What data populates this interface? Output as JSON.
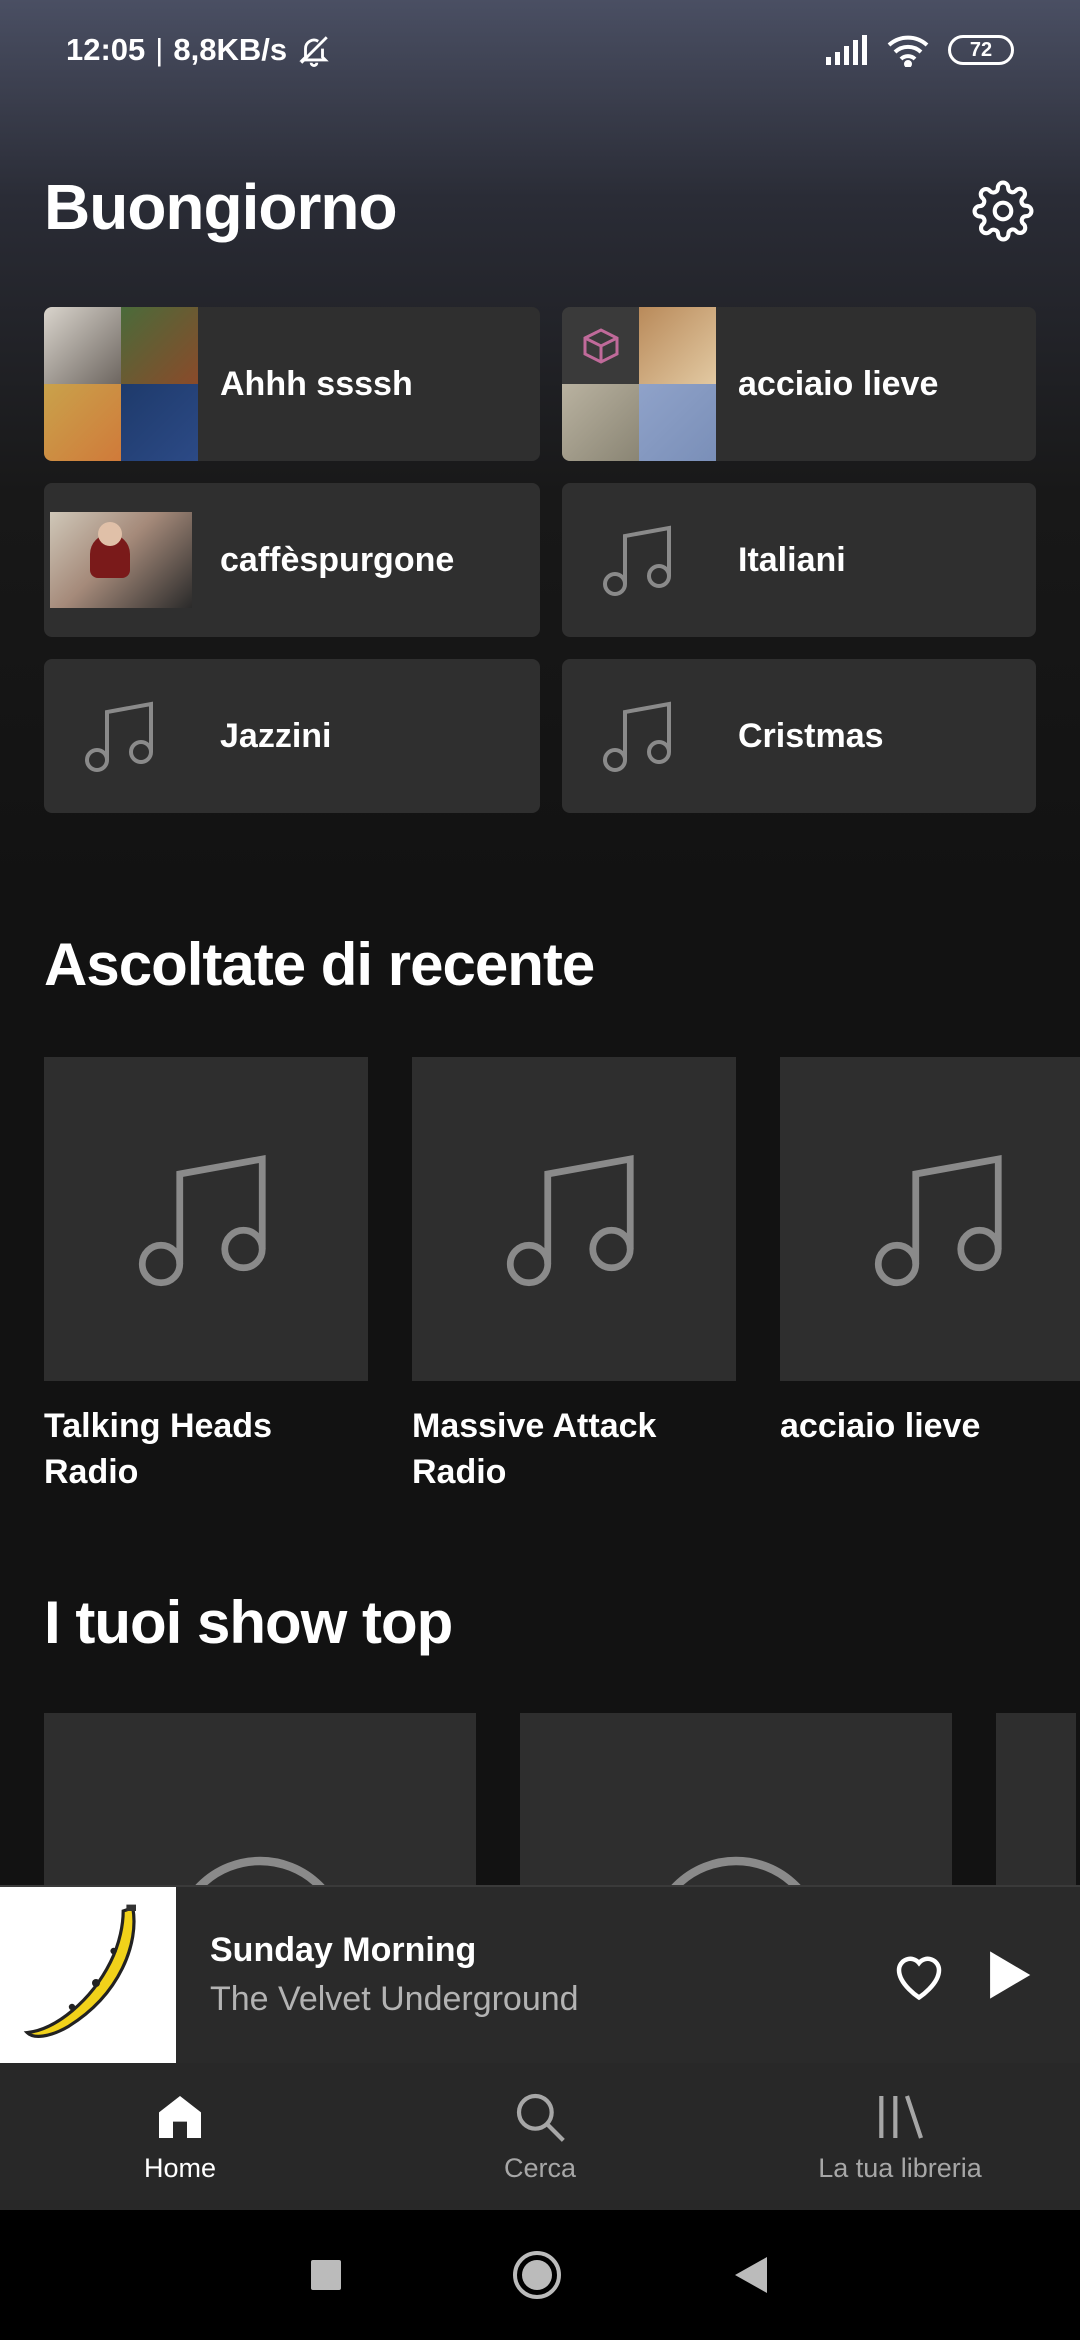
{
  "status_bar": {
    "time": "12:05",
    "separator": "|",
    "network_speed": "8,8KB/s",
    "battery": "72"
  },
  "header": {
    "greeting": "Buongiorno"
  },
  "shortcuts": [
    {
      "label": "Ahhh ssssh",
      "art": "mosaic"
    },
    {
      "label": "acciaio lieve",
      "art": "mosaic"
    },
    {
      "label": "caffèspurgone",
      "art": "photo"
    },
    {
      "label": "Italiani",
      "art": "music-note-icon"
    },
    {
      "label": "Jazzini",
      "art": "music-note-icon"
    },
    {
      "label": "Cristmas",
      "art": "music-note-icon"
    }
  ],
  "recent": {
    "title": "Ascoltate di recente",
    "items": [
      {
        "line1": "Talking Heads",
        "line2": "Radio"
      },
      {
        "line1": "Massive Attack",
        "line2": "Radio"
      },
      {
        "line1": "acciaio lieve",
        "line2": ""
      }
    ]
  },
  "shows": {
    "title": "I tuoi show top"
  },
  "player": {
    "song": "Sunday Morning",
    "artist": "The Velvet Underground"
  },
  "nav": {
    "home": "Home",
    "search": "Cerca",
    "library": "La tua libreria"
  },
  "colors": {
    "background": "#121212",
    "tile": "#2f2f2f",
    "player": "#2a2a2a",
    "nav": "#282828",
    "muted_text": "#b3b3b3"
  }
}
